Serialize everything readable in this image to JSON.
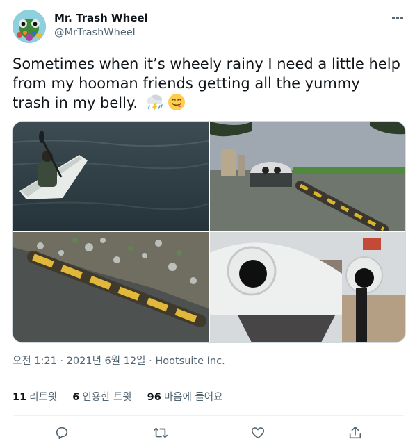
{
  "author": {
    "name": "Mr. Trash Wheel",
    "handle": "@MrTrashWheel"
  },
  "tweet": {
    "text": "Sometimes when it’s wheely rainy I need a little help from my hooman friends getting all the yummy trash in my belly.",
    "emojis": [
      "cloud-with-lightning-and-rain-icon",
      "face-savoring-food-icon"
    ]
  },
  "media": {
    "photos": [
      "kayak-in-harbor",
      "trash-wheel-from-shore",
      "floating-trash-boom",
      "trash-wheel-googly-eyes"
    ]
  },
  "meta": {
    "timestamp": "오전 1:21 · 2021년 6월 12일 · ",
    "source": "Hootsuite Inc."
  },
  "stats": {
    "retweets_count": "11",
    "retweets_label": "리트윗",
    "quotes_count": "6",
    "quotes_label": "인용한 트윗",
    "likes_count": "96",
    "likes_label": "마음에 들어요"
  },
  "colors": {
    "text_primary": "#0f1419",
    "text_secondary": "#536471",
    "divider": "#eff3f4"
  }
}
